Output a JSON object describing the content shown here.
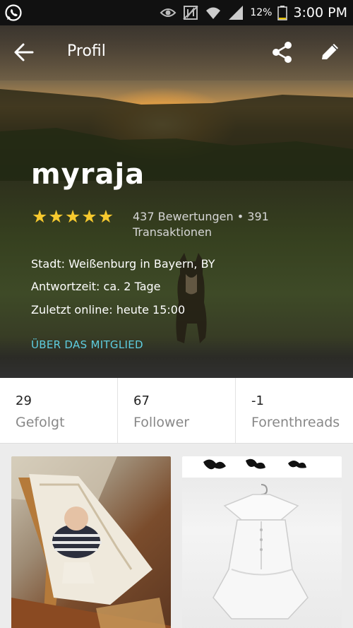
{
  "status_bar": {
    "battery_percent": "12%",
    "time": "3:00 PM",
    "icons": [
      "whatsapp-icon",
      "eye-icon",
      "nfc-icon",
      "wifi-icon",
      "signal-icon",
      "battery-icon"
    ]
  },
  "app_bar": {
    "title": "Profil",
    "icons": [
      "back-arrow-icon",
      "share-icon",
      "edit-pencil-icon"
    ]
  },
  "profile": {
    "username": "myraja",
    "rating_stars": 5,
    "reviews_text": "437 Bewertungen • 391 Transaktionen",
    "city": "Stadt: Weißenburg in Bayern, BY",
    "response_time": "Antwortzeit:  ca. 2 Tage",
    "last_online": "Zuletzt online: heute 15:00",
    "about_link": "ÜBER DAS MITGLIED"
  },
  "stats": [
    {
      "value": "29",
      "label": "Gefolgt"
    },
    {
      "value": "67",
      "label": "Follower"
    },
    {
      "value": "-1",
      "label": "Forenthreads"
    }
  ],
  "colors": {
    "accent_link": "#5ecde0",
    "star": "#f6c92e",
    "status_bar": "#111111"
  }
}
